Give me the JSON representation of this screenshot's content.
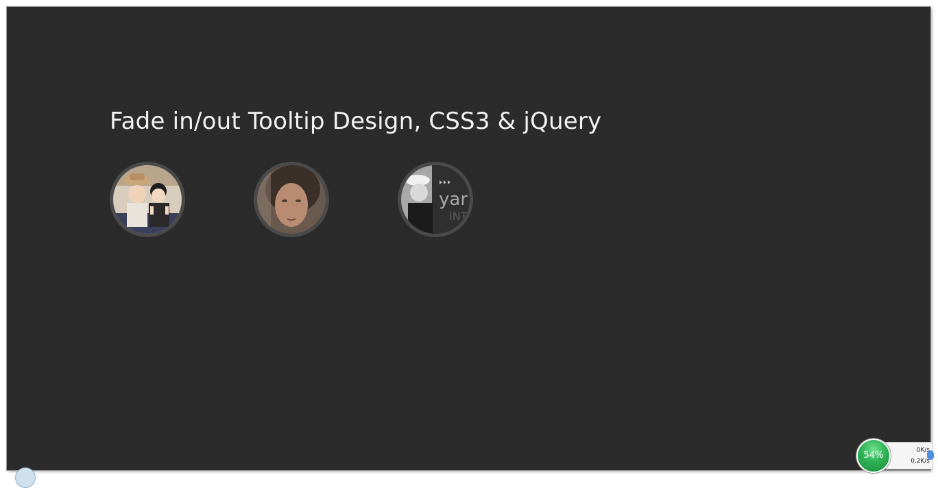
{
  "page": {
    "title": "Fade in/out Tooltip Design, CSS3 & jQuery"
  },
  "avatars": [
    {
      "name": "avatar-1"
    },
    {
      "name": "avatar-2"
    },
    {
      "name": "avatar-3"
    }
  ],
  "avatar_3_text": {
    "word": "yar",
    "sub": "INT"
  },
  "tray": {
    "cpu_percent": "54%",
    "upload_speed": "0K/s",
    "download_speed": "0.2K/s",
    "cpu_value": 54
  },
  "colors": {
    "background": "#2b2b2b",
    "avatar_border": "#4a4a4a",
    "title_text": "#f2f2f2",
    "tray_green": "#2fb256"
  },
  "icons": [
    "arrow-up-icon",
    "arrow-down-icon"
  ]
}
